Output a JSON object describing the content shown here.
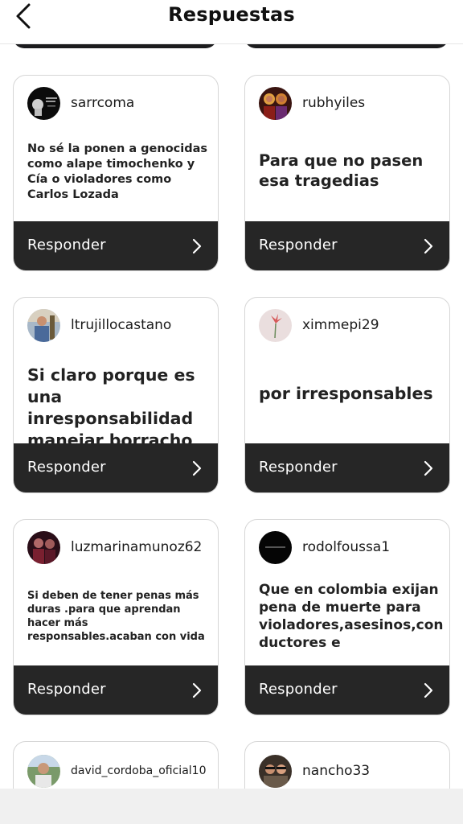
{
  "header": {
    "title": "Respuestas"
  },
  "colors": {
    "button_bg": "#262626",
    "card_border": "#d6d6d6"
  },
  "replies": [
    {
      "username": "sarrcoma",
      "text": "No sé la ponen a genocidas\ncomo alape timochenko y\nCía o violadores como\nCarlos Lozada",
      "button": "Responder"
    },
    {
      "username": "rubhyiles",
      "text": "Para que no pasen\nesa tragedias",
      "button": "Responder"
    },
    {
      "username": "ltrujillocastano",
      "text": "Si claro porque es una\ninresponsabilidad\nmanejar borracho",
      "button": "Responder"
    },
    {
      "username": "ximmepi29",
      "text": "por irresponsables",
      "button": "Responder"
    },
    {
      "username": "luzmarinamunoz62",
      "text": "Si deben de tener penas más\nduras .para que aprendan\nhacer más\nresponsables.acaban con vida",
      "button": "Responder"
    },
    {
      "username": "rodolfoussa1",
      "text": "Que  en colombia  exijan\npena de muerte  para\nvioladores,asesinos,con\nductores e",
      "button": "Responder"
    },
    {
      "username": "david_cordoba_oficial10"
    },
    {
      "username": "nancho33"
    }
  ]
}
